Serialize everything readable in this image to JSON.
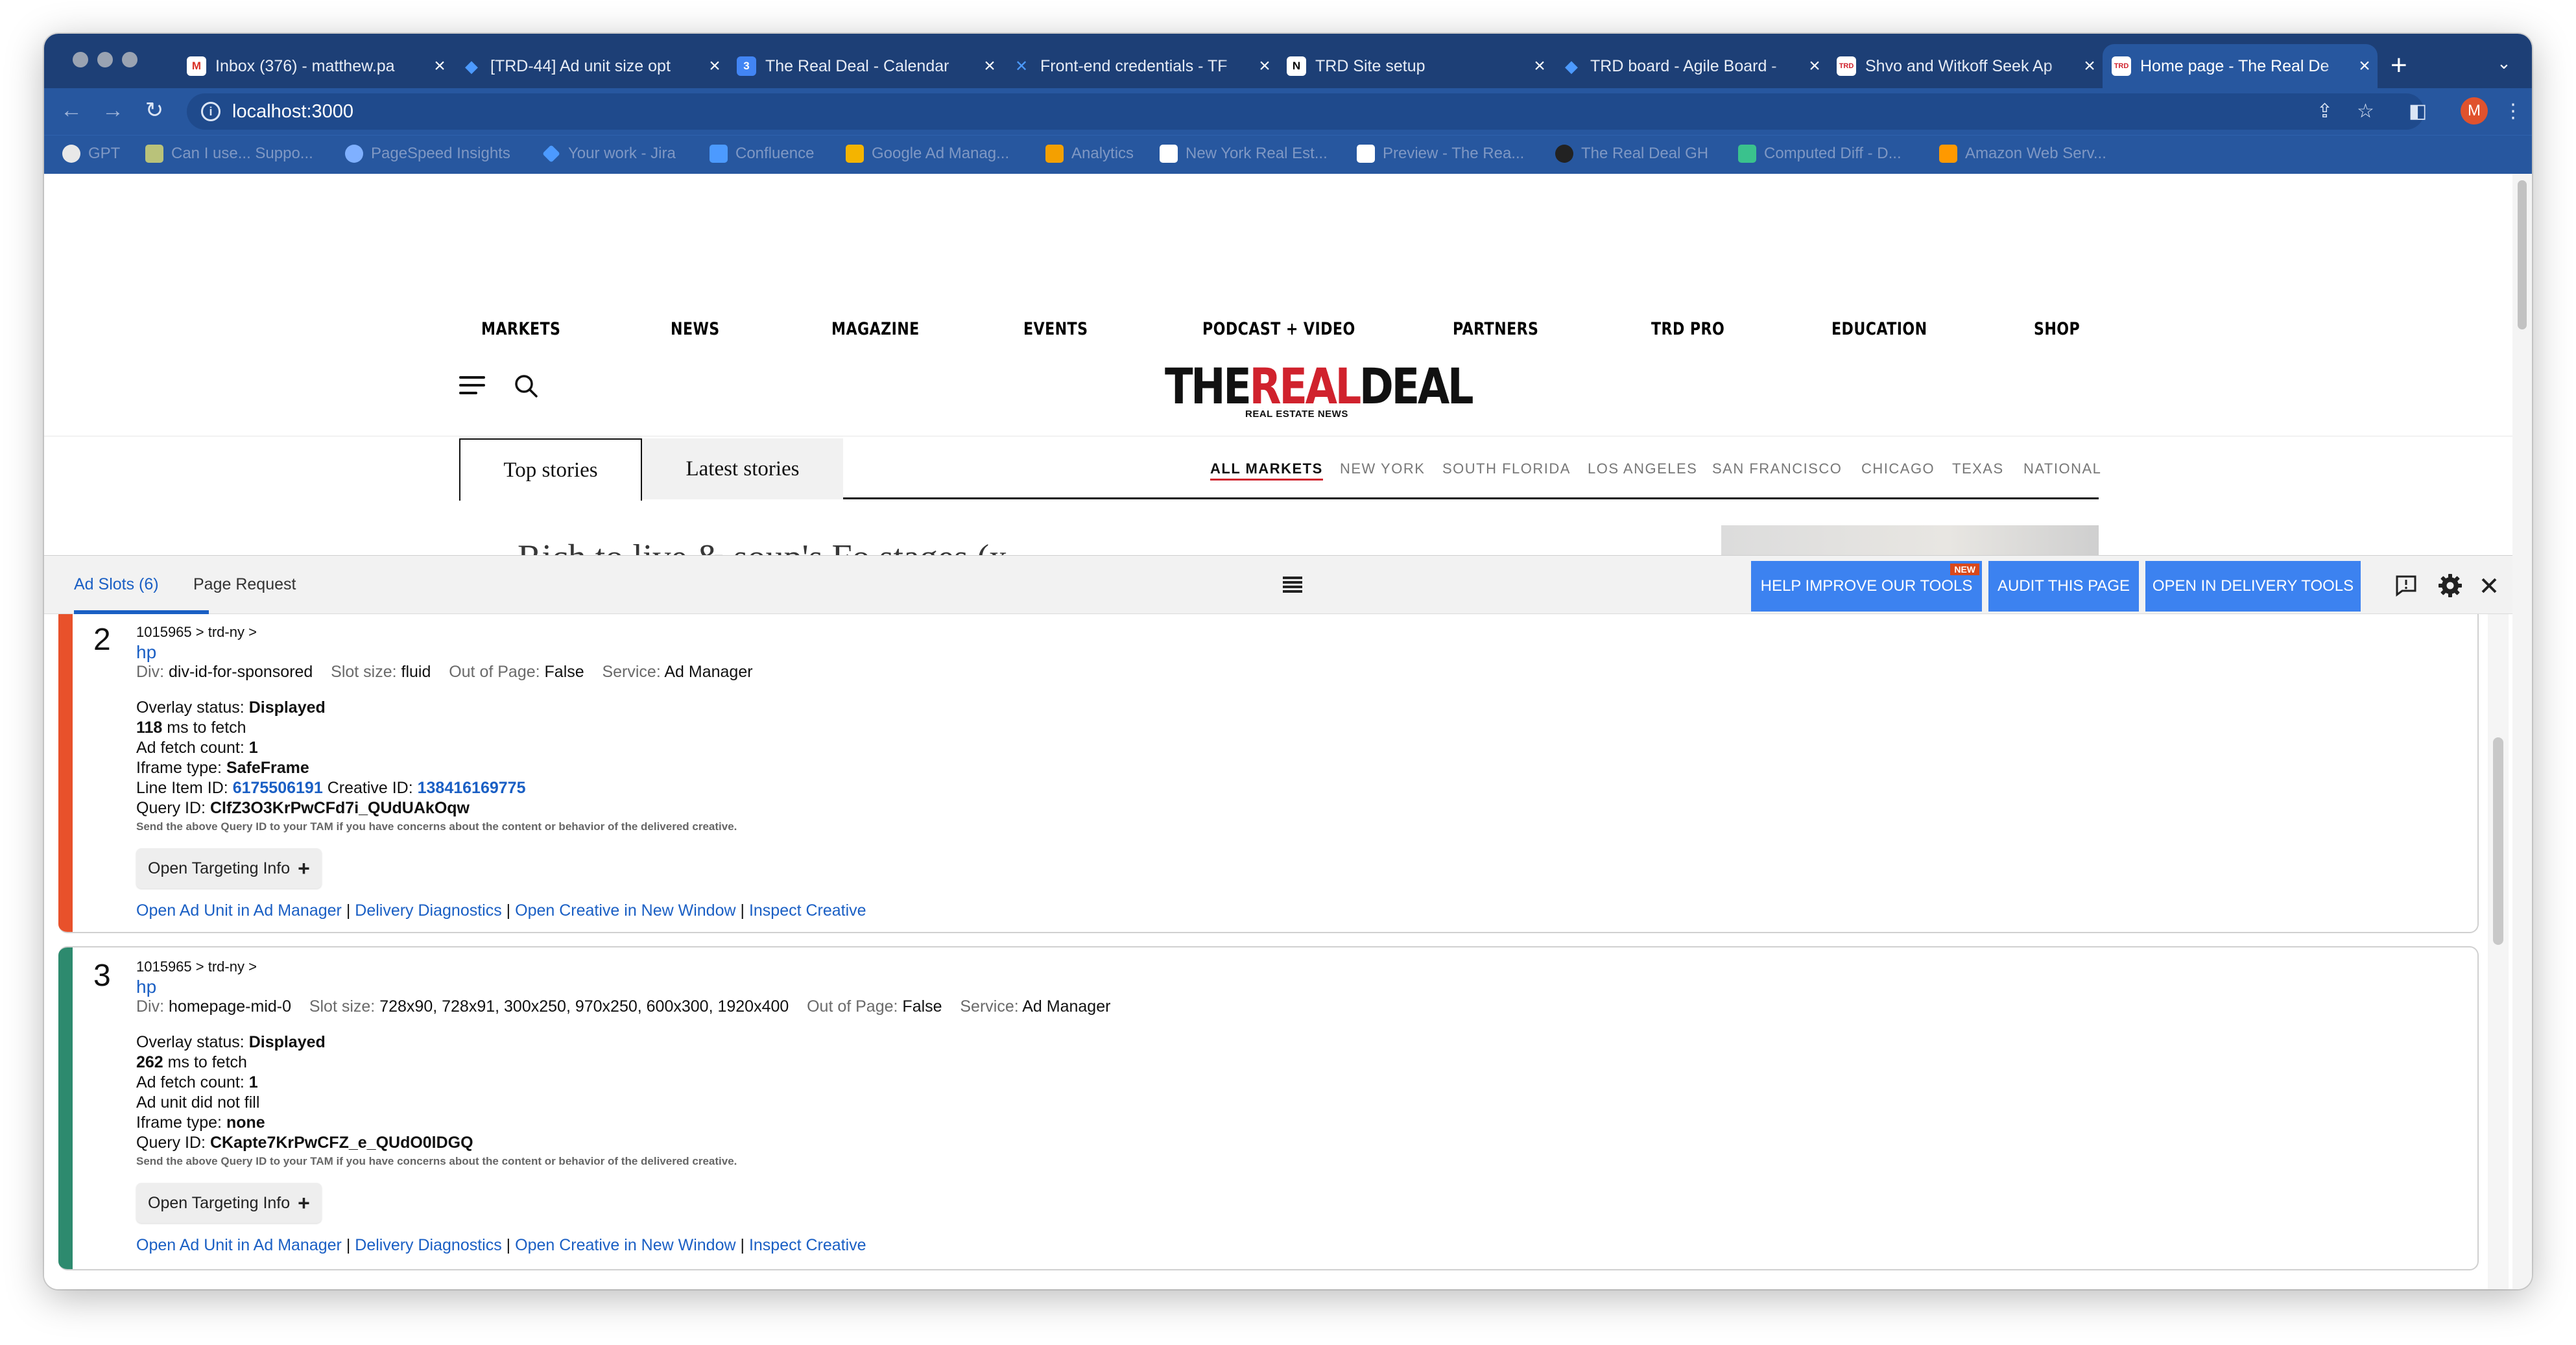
{
  "browser": {
    "tabs": [
      {
        "label": "Inbox (376) - matthew.pa",
        "favicon_text": "M",
        "favicon_color": "#ffffff",
        "favicon_fg": "#d93025"
      },
      {
        "label": "[TRD-44] Ad unit size opt",
        "favicon_text": "◆",
        "favicon_color": "#1d3f76",
        "favicon_fg": "#4c9aff"
      },
      {
        "label": "The Real Deal - Calendar",
        "favicon_text": "3",
        "favicon_color": "#4285f4",
        "favicon_fg": "#ffffff"
      },
      {
        "label": "Front-end credentials - TF",
        "favicon_text": "✕",
        "favicon_color": "#1d3f76",
        "favicon_fg": "#4c9aff"
      },
      {
        "label": "TRD Site setup",
        "favicon_text": "N",
        "favicon_color": "#ffffff",
        "favicon_fg": "#000000"
      },
      {
        "label": "TRD board - Agile Board -",
        "favicon_text": "◆",
        "favicon_color": "#1d3f76",
        "favicon_fg": "#4c9aff"
      },
      {
        "label": "Shvo and Witkoff Seek Ap",
        "favicon_text": "TRD",
        "favicon_color": "#ffffff",
        "favicon_fg": "#d0222d"
      },
      {
        "label": "Home page - The Real De",
        "favicon_text": "TRD",
        "favicon_color": "#ffffff",
        "favicon_fg": "#d0222d",
        "active": true
      }
    ],
    "new_tab_symbol": "+",
    "tab_menu_symbol": "⌄",
    "address": "localhost:3000",
    "profile_initial": "M",
    "bookmarks": [
      {
        "label": "GPT",
        "color": "#e8e8e8"
      },
      {
        "label": "Can I use... Suppo...",
        "color": "#b9c27a"
      },
      {
        "label": "PageSpeed Insights",
        "color": "#7fb0ff"
      },
      {
        "label": "Your work - Jira",
        "color": "#4c9aff"
      },
      {
        "label": "Confluence",
        "color": "#4c9aff"
      },
      {
        "label": "Google Ad Manag...",
        "color": "#f4b400"
      },
      {
        "label": "Analytics",
        "color": "#f4a000"
      },
      {
        "label": "New York Real Est...",
        "color": "#ffffff"
      },
      {
        "label": "Preview - The Rea...",
        "color": "#ffffff"
      },
      {
        "label": "The Real Deal GH",
        "color": "#222222"
      },
      {
        "label": "Computed Diff - D...",
        "color": "#3ac28d"
      },
      {
        "label": "Amazon Web Serv...",
        "color": "#ff9900"
      }
    ]
  },
  "site": {
    "nav": [
      "MARKETS",
      "NEWS",
      "MAGAZINE",
      "EVENTS",
      "PODCAST + VIDEO",
      "PARTNERS",
      "TRD PRO",
      "EDUCATION",
      "SHOP"
    ],
    "logo": {
      "part1": "THE",
      "part2": "REAL",
      "part3": "DEAL",
      "tagline": "REAL ESTATE NEWS"
    },
    "story_tabs": {
      "active": "Top stories",
      "inactive": "Latest stories"
    },
    "markets": [
      "ALL MARKETS",
      "NEW YORK",
      "SOUTH FLORIDA",
      "LOS ANGELES",
      "SAN FRANCISCO",
      "CHICAGO",
      "TEXAS",
      "NATIONAL"
    ],
    "headline_peek": "Rich to live & soup's Fo stages  (x  "
  },
  "console": {
    "tabs": {
      "ad_slots": "Ad Slots (6)",
      "page_request": "Page Request"
    },
    "buttons": {
      "help": "HELP IMPROVE OUR TOOLS",
      "new_badge": "NEW",
      "audit": "AUDIT THIS PAGE",
      "delivery": "OPEN IN DELIVERY TOOLS"
    },
    "icons": {
      "feedback": "feedback-icon",
      "settings": "gear-icon",
      "close": "close-icon"
    },
    "slots": [
      {
        "number": "2",
        "accent_color": "#e8512b",
        "path": "1015965 >   trd-ny >",
        "unit": "hp",
        "div_label": "Div:",
        "div": "div-id-for-sponsored",
        "size_label": "Slot size:",
        "size": "fluid",
        "oop_label": "Out of Page:",
        "oop": "False",
        "service_label": "Service:",
        "service": "Ad Manager",
        "overlay_label": "Overlay status:",
        "overlay": "Displayed",
        "fetch_ms": "118",
        "fetch_suffix": "ms to fetch",
        "fetch_count_label": "Ad fetch count:",
        "fetch_count": "1",
        "fill_text": "",
        "iframe_label": "Iframe type:",
        "iframe": "SafeFrame",
        "line_item_label": "Line Item ID:",
        "line_item": "6175506191",
        "creative_label": "Creative ID:",
        "creative": "138416169775",
        "query_label": "Query ID:",
        "query": "ClfZ3O3KrPwCFd7i_QUdUAkOqw",
        "note": "Send the above Query ID to your TAM if you have concerns about the content or behavior of the delivered creative.",
        "targeting_btn": "Open Targeting Info",
        "links": [
          "Open Ad Unit in Ad Manager",
          "Delivery Diagnostics",
          "Open Creative in New Window",
          "Inspect Creative"
        ]
      },
      {
        "number": "3",
        "accent_color": "#2d8a6e",
        "path": "1015965 >   trd-ny >",
        "unit": "hp",
        "div_label": "Div:",
        "div": "homepage-mid-0",
        "size_label": "Slot size:",
        "size": "728x90, 728x91, 300x250, 970x250, 600x300, 1920x400",
        "oop_label": "Out of Page:",
        "oop": "False",
        "service_label": "Service:",
        "service": "Ad Manager",
        "overlay_label": "Overlay status:",
        "overlay": "Displayed",
        "fetch_ms": "262",
        "fetch_suffix": "ms to fetch",
        "fetch_count_label": "Ad fetch count:",
        "fetch_count": "1",
        "fill_text": "Ad unit did not fill",
        "iframe_label": "Iframe type:",
        "iframe": "none",
        "query_label": "Query ID:",
        "query": "CKapte7KrPwCFZ_e_QUdO0lDGQ",
        "note": "Send the above Query ID to your TAM if you have concerns about the content or behavior of the delivered creative.",
        "targeting_btn": "Open Targeting Info",
        "links": [
          "Open Ad Unit in Ad Manager",
          "Delivery Diagnostics",
          "Open Creative in New Window",
          "Inspect Creative"
        ]
      }
    ]
  }
}
